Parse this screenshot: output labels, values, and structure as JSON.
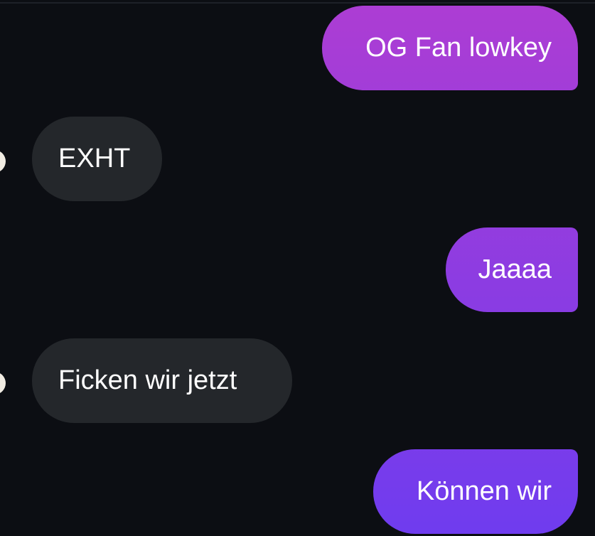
{
  "colors": {
    "background": "#0c0e13",
    "incoming_bubble": "#24272b",
    "outgoing_gradient_top": "#ad3dd3",
    "outgoing_gradient_bottom": "#6f3cef",
    "text": "#ffffff"
  },
  "messages": [
    {
      "direction": "outgoing",
      "text": "OG Fan lowkey"
    },
    {
      "direction": "incoming",
      "text": "EXHT"
    },
    {
      "direction": "outgoing",
      "text": "Jaaaa"
    },
    {
      "direction": "incoming",
      "text": "Ficken wir jetzt"
    },
    {
      "direction": "outgoing",
      "text": "Können wir"
    }
  ]
}
